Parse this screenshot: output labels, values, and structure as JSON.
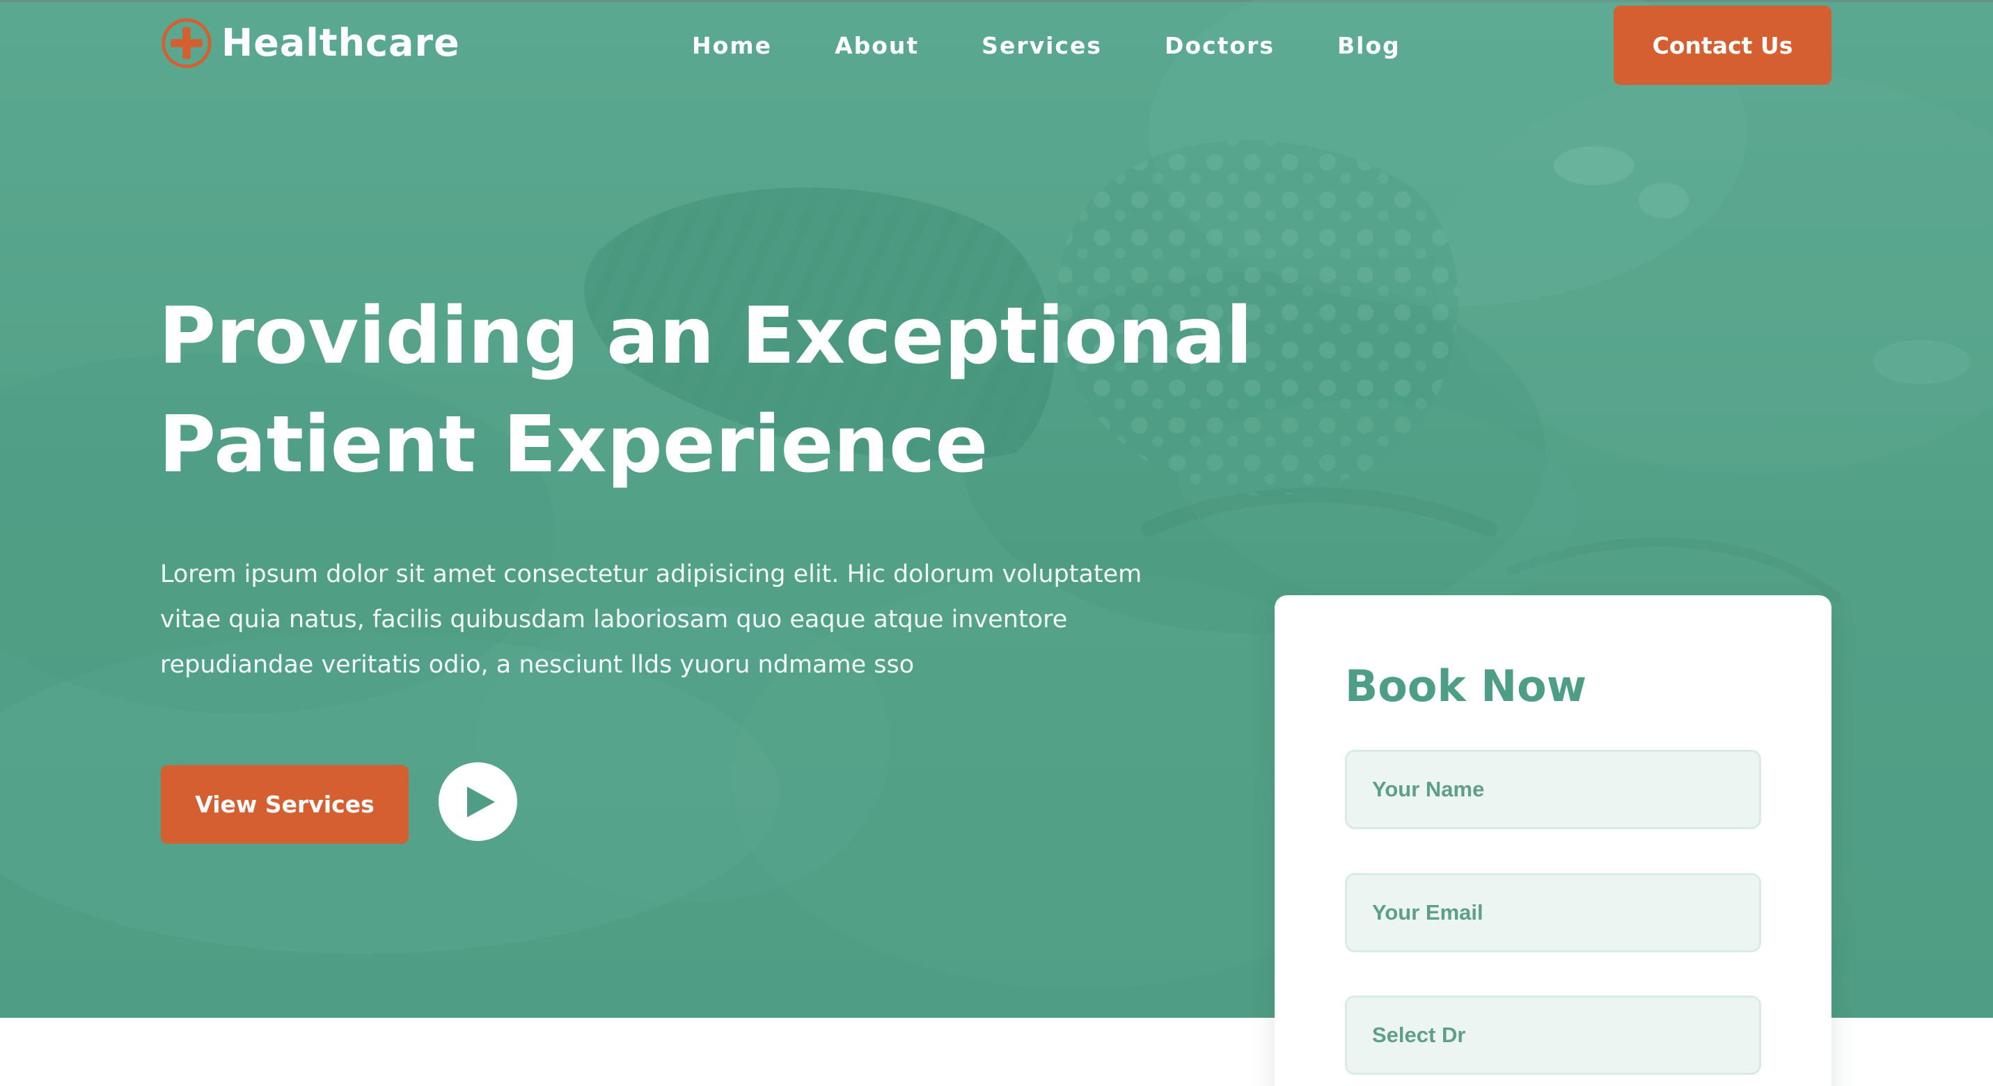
{
  "colors": {
    "brand_green": "#53a187",
    "accent_orange": "#d65f31",
    "white": "#ffffff",
    "input_bg": "#edf5f2",
    "input_text": "#5e9f89"
  },
  "brand": {
    "name": "Healthcare",
    "icon": "plus-circle-icon"
  },
  "nav": {
    "items": [
      {
        "label": "Home"
      },
      {
        "label": "About"
      },
      {
        "label": "Services"
      },
      {
        "label": "Doctors"
      },
      {
        "label": "Blog"
      }
    ],
    "cta_label": "Contact Us"
  },
  "hero": {
    "headline_line1": "Providing an Exceptional",
    "headline_line2": "Patient Experience",
    "description": "Lorem ipsum dolor sit amet consectetur adipisicing elit. Hic dolorum voluptatem vitae quia natus, facilis quibusdam laboriosam quo eaque atque inventore repudiandae veritatis odio, a nesciunt llds yuoru ndmame sso",
    "primary_button_label": "View Services",
    "play_icon": "play-icon"
  },
  "booking": {
    "title": "Book Now",
    "name_placeholder": "Your Name",
    "email_placeholder": "Your Email",
    "doctor_select_value": "Select Dr"
  }
}
